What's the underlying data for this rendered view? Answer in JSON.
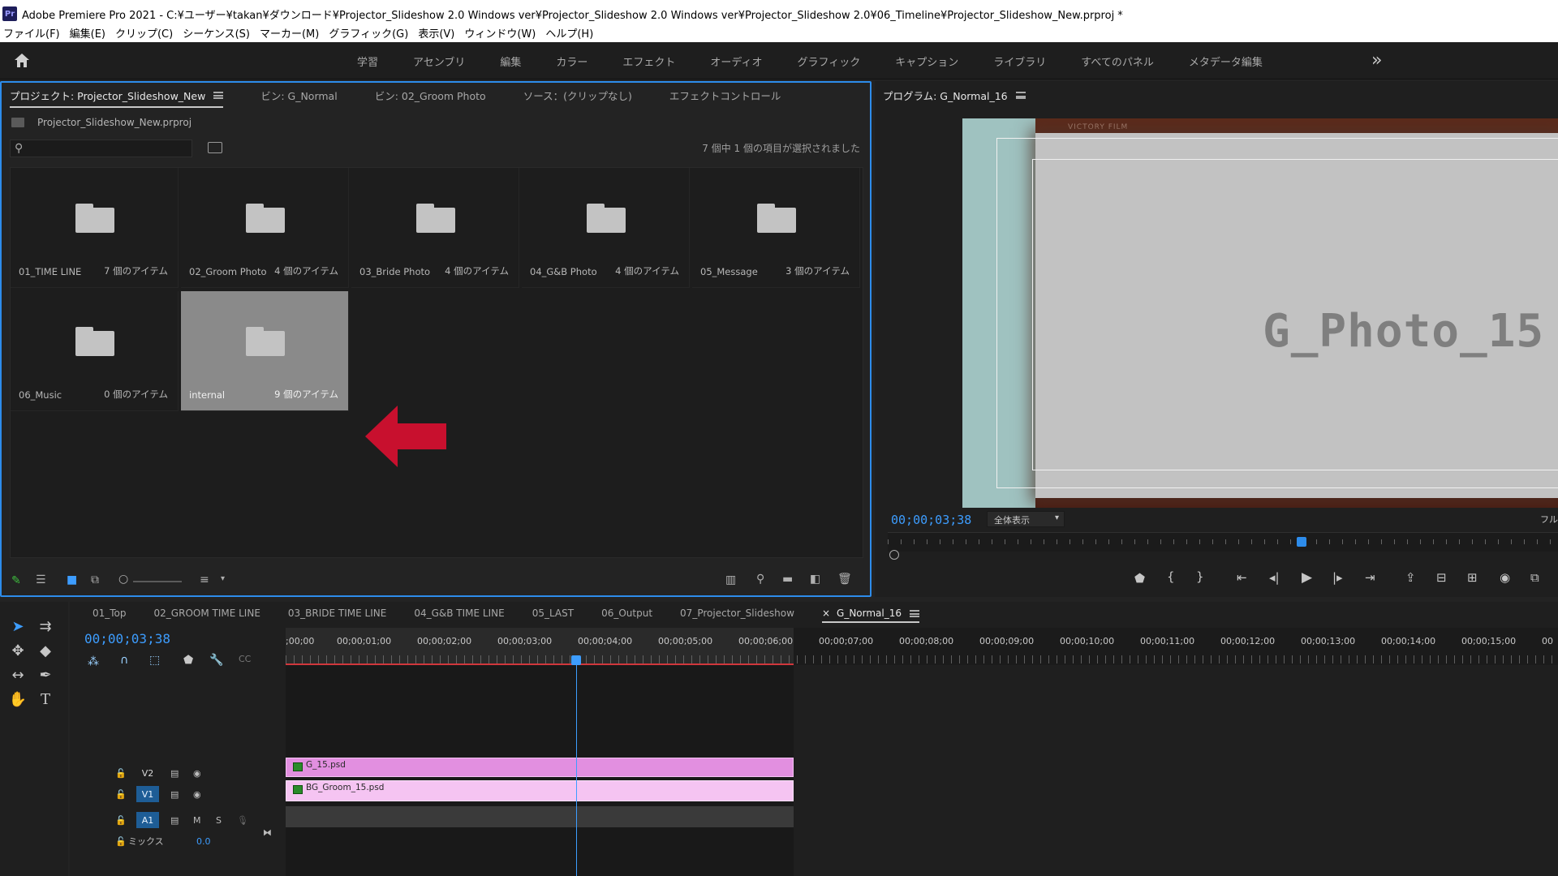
{
  "window": {
    "app_icon_text": "Pr",
    "title": "Adobe Premiere Pro 2021 - C:¥ユーザー¥takan¥ダウンロード¥Projector_Slideshow 2.0 Windows ver¥Projector_Slideshow 2.0 Windows ver¥Projector_Slideshow 2.0¥06_Timeline¥Projector_Slideshow_New.prproj *"
  },
  "menu": [
    "ファイル(F)",
    "編集(E)",
    "クリップ(C)",
    "シーケンス(S)",
    "マーカー(M)",
    "グラフィック(G)",
    "表示(V)",
    "ウィンドウ(W)",
    "ヘルプ(H)"
  ],
  "workspaces": [
    "学習",
    "アセンブリ",
    "編集",
    "カラー",
    "エフェクト",
    "オーディオ",
    "グラフィック",
    "キャプション",
    "ライブラリ",
    "すべてのパネル",
    "メタデータ編集"
  ],
  "workspace_more": "»",
  "project": {
    "tabs": [
      "プロジェクト: Projector_Slideshow_New",
      "ビン: G_Normal",
      "ビン: 02_Groom Photo",
      "ソース：(クリップなし)",
      "エフェクトコントロール"
    ],
    "file_name": "Projector_Slideshow_New.prproj",
    "search_placeholder": "",
    "selection_status": "7 個中 1 個の項目が選択されました",
    "bins": [
      {
        "name": "01_TIME LINE",
        "count": "7 個のアイテム",
        "selected": false
      },
      {
        "name": "02_Groom Photo",
        "count": "4 個のアイテム",
        "selected": false
      },
      {
        "name": "03_Bride Photo",
        "count": "4 個のアイテム",
        "selected": false
      },
      {
        "name": "04_G&B Photo",
        "count": "4 個のアイテム",
        "selected": false
      },
      {
        "name": "05_Message",
        "count": "3 個のアイテム",
        "selected": false
      },
      {
        "name": "06_Music",
        "count": "0 個のアイテム",
        "selected": false
      },
      {
        "name": "internal",
        "count": "9 個のアイテム",
        "selected": true
      }
    ]
  },
  "program": {
    "tab": "プログラム: G_Normal_16",
    "video_header_text": "VICTORY FILM",
    "video_text": "G_Photo_15",
    "timecode": "00;00;03;38",
    "zoom": "全体表示",
    "full_label": "フル",
    "playhead_position": 0.61
  },
  "timeline": {
    "tabs": [
      "01_Top",
      "02_GROOM TIME LINE",
      "03_BRIDE TIME LINE",
      "04_G&B TIME LINE",
      "05_LAST",
      "06_Output",
      "07_Projector_Slideshow",
      "G_Normal_16"
    ],
    "close_glyph": "×",
    "timecode": "00;00;03;38",
    "ruler_labels": [
      ";00;00",
      "00;00;01;00",
      "00;00;02;00",
      "00;00;03;00",
      "00;00;04;00",
      "00;00;05;00",
      "00;00;06;00",
      "00;00;07;00",
      "00;00;08;00",
      "00;00;09;00",
      "00;00;10;00",
      "00;00;11;00",
      "00;00;12;00",
      "00;00;13;00",
      "00;00;14;00",
      "00;00;15;00",
      "00"
    ],
    "tracks": {
      "v2": {
        "label": "V2",
        "clip": "G_15.psd"
      },
      "v1": {
        "label": "V1",
        "clip": "BG_Groom_15.psd"
      },
      "a1": {
        "label": "A1",
        "m": "M",
        "s": "S"
      },
      "mix": {
        "label": "ミックス",
        "value": "0.0"
      }
    }
  }
}
